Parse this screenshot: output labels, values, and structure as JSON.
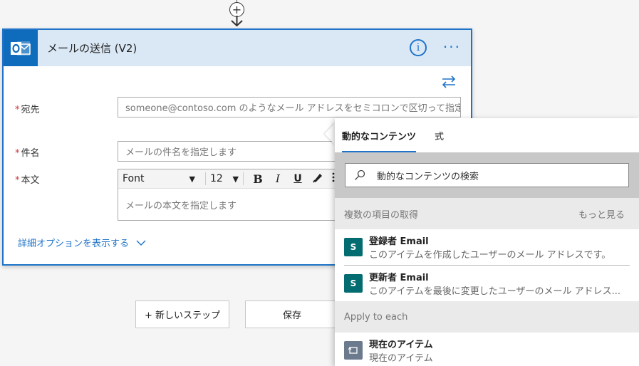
{
  "connector": {
    "add_symbol": "+"
  },
  "card": {
    "title": "メールの送信 (V2)",
    "info_symbol": "i",
    "more_symbol": "···",
    "fields": {
      "to": {
        "label": "宛先",
        "required_mark": "*",
        "placeholder": "someone@contoso.com のようなメール アドレスをセミコロンで区切って指定"
      },
      "subject": {
        "label": "件名",
        "required_mark": "*",
        "placeholder": "メールの件名を指定します"
      },
      "body": {
        "label": "本文",
        "required_mark": "*",
        "placeholder": "メールの本文を指定します"
      }
    },
    "toolbar": {
      "font_value": "Font",
      "size_value": "12",
      "bold": "B",
      "italic": "I",
      "underline": "U"
    },
    "advanced_link": "詳細オプションを表示する"
  },
  "buttons": {
    "new_step": "+ 新しいステップ",
    "save": "保存"
  },
  "popup": {
    "tabs": [
      "動的なコンテンツ",
      "式"
    ],
    "search_placeholder": "動的なコンテンツの検索",
    "groups": [
      {
        "title": "複数の項目の取得",
        "more_label": "もっと見る",
        "items": [
          {
            "title": "登録者 Email",
            "desc": "このアイテムを作成したユーザーのメール アドレスです。"
          },
          {
            "title": "更新者 Email",
            "desc": "このアイテムを最後に変更したユーザーのメール アドレス..."
          }
        ]
      },
      {
        "title": "Apply to each",
        "items": [
          {
            "title": "現在のアイテム",
            "desc": "現在のアイテム"
          }
        ]
      }
    ]
  },
  "colors": {
    "accent": "#1f74c9",
    "header_bg": "#dae8f6",
    "outlook_blue": "#0f6cbd",
    "sharepoint_teal": "#036c70",
    "required_red": "#d13438"
  }
}
